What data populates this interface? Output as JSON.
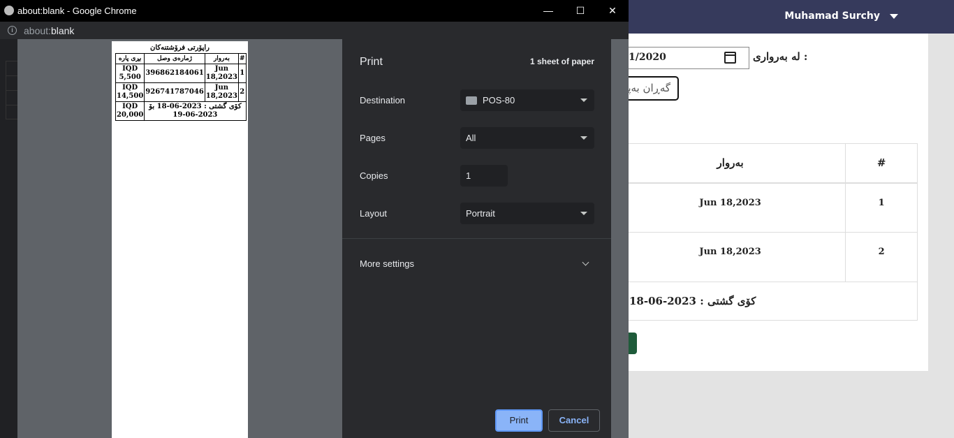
{
  "app": {
    "user_name": "Muhamad Surchy",
    "date_label": "لە بەرواری :",
    "date_value": "1/2020",
    "search_button": "گەڕان بەپێ",
    "table": {
      "headers": [
        "بەروار",
        "#"
      ],
      "rows": [
        {
          "date": "Jun 18,2023",
          "index": "1"
        },
        {
          "date": "Jun 18,2023",
          "index": "2"
        }
      ],
      "total": "کۆی گشتی : 2023-06-18"
    }
  },
  "chrome": {
    "window_title": "about:blank - Google Chrome",
    "url_scheme": "about:",
    "url_path": "blank",
    "minimize": "—",
    "maximize": "☐",
    "close": "✕"
  },
  "receipt": {
    "title": "راپۆرتی فرۆشتنەکان",
    "headers": [
      "بڕی پارە",
      "ژمارەی وصل",
      "بەروار",
      "#"
    ],
    "rows": [
      {
        "amount": "IQD 5,500",
        "invoice": "396862184061",
        "date": "Jun 18,2023",
        "index": "1"
      },
      {
        "amount": "IQD 14,500",
        "invoice": "926741787046",
        "date": "Jun 18,2023",
        "index": "2"
      }
    ],
    "total_amount": "IQD 20,000",
    "total_text": "کۆی گشتی : 2023-06-18 بۆ 2023-06-19"
  },
  "print": {
    "title": "Print",
    "sheet_count": "1 sheet of paper",
    "destination_label": "Destination",
    "destination_value": "POS-80",
    "pages_label": "Pages",
    "pages_value": "All",
    "copies_label": "Copies",
    "copies_value": "1",
    "layout_label": "Layout",
    "layout_value": "Portrait",
    "more_settings": "More settings",
    "print_button": "Print",
    "cancel_button": "Cancel"
  }
}
